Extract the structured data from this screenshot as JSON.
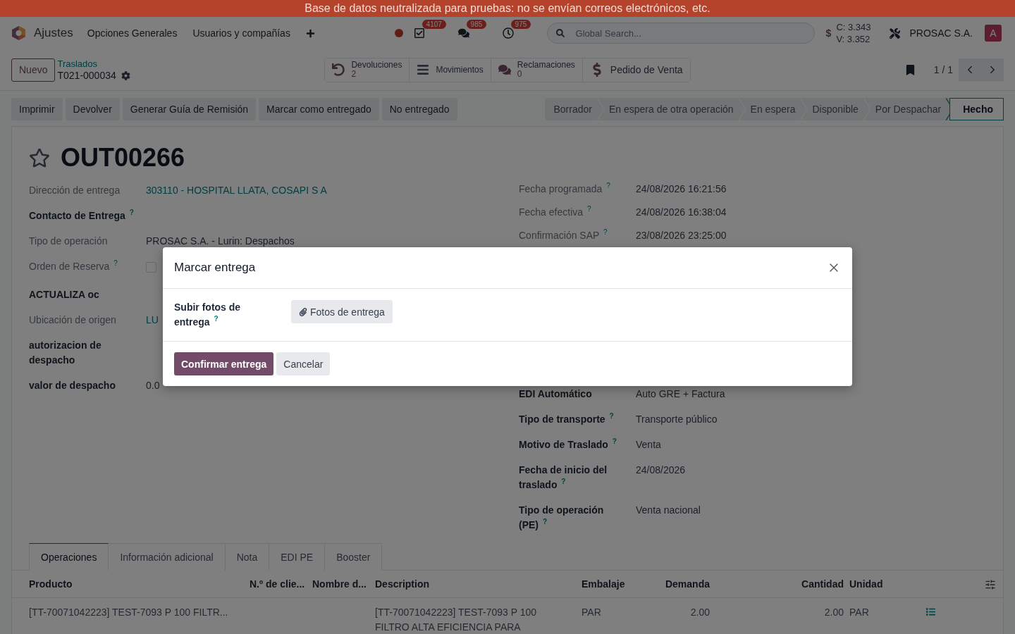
{
  "banner": "Base de datos neutralizada para pruebas: no se envían correos electrónicos, etc.",
  "navbar": {
    "app": "Ajustes",
    "menus": [
      "Opciones Generales",
      "Usuarios y compañías"
    ],
    "notifications": [
      {
        "kind": "activities",
        "count": "4107"
      },
      {
        "kind": "messages",
        "count": "985"
      },
      {
        "kind": "clock",
        "count": "975"
      }
    ],
    "search": {
      "placeholder": "Global Search..."
    },
    "currency": {
      "symbol": "$",
      "lines": [
        "C: 3.343",
        "V: 3.352"
      ]
    },
    "company": "PROSAC S.A.",
    "avatar": "A"
  },
  "control_panel": {
    "new_button": "Nuevo",
    "breadcrumb": {
      "parent": "Traslados",
      "current": "T021-000034"
    },
    "smart_buttons": [
      {
        "kind": "returns",
        "label": "Devoluciones",
        "value": "2"
      },
      {
        "kind": "moves",
        "label": "Movimientos"
      },
      {
        "kind": "claims",
        "label": "Reclamaciones",
        "value": "0"
      },
      {
        "kind": "sale",
        "label": "Pedido de Venta"
      }
    ],
    "pager": "1 / 1"
  },
  "actions": [
    "Imprimir",
    "Devolver",
    "Generar Guía de Remisión",
    "Marcar como entregado",
    "No entregado"
  ],
  "statusbar": [
    {
      "label": "Borrador",
      "selected": false
    },
    {
      "label": "En espera de otra operación",
      "selected": false
    },
    {
      "label": "En espera",
      "selected": false
    },
    {
      "label": "Disponible",
      "selected": false
    },
    {
      "label": "Por Despachar",
      "selected": false
    },
    {
      "label": "Hecho",
      "selected": true
    }
  ],
  "form": {
    "starred": false,
    "title": "OUT00266",
    "left": [
      {
        "label": "Dirección de entrega",
        "readonly": true,
        "kind": "link",
        "value": "303110 - HOSPITAL LLATA, COSAPI S A"
      },
      {
        "label": "Contacto de Entrega $^{?}$",
        "readonly": false,
        "kind": "text"
      },
      {
        "label": "Tipo de operación",
        "readonly": true,
        "kind": "text",
        "value": "PROSAC S.A. - Lurin: Despachos"
      },
      {
        "label": "Orden de Reserva $^{?}$",
        "readonly": true,
        "kind": "checkbox",
        "checked": false
      },
      {
        "label": "ACTUALIZA oc",
        "readonly": false,
        "kind": "text"
      },
      {
        "label": "Ubicación de origen",
        "readonly": true,
        "kind": "link",
        "value": "LU"
      },
      {
        "label": "autorizacion de despacho",
        "readonly": false,
        "kind": "text"
      },
      {
        "label": "valor de despacho",
        "readonly": false,
        "kind": "text",
        "value": "0.0"
      }
    ],
    "right_upper": [
      {
        "label": "Fecha programada $^{?}$",
        "readonly": true,
        "kind": "text",
        "value": "24/08/2026 16:21:56"
      },
      {
        "label": "Fecha efectiva $^{?}$",
        "readonly": true,
        "kind": "text",
        "value": "24/08/2026 16:38:04"
      },
      {
        "label": "Confirmación SAP $^{?}$",
        "readonly": true,
        "kind": "text",
        "value": "23/08/2026 23:25:00"
      }
    ],
    "right_lower": [
      {
        "label": "EDI Automático",
        "readonly": false,
        "kind": "text",
        "value": "Auto GRE + Factura"
      },
      {
        "label": "Tipo de transporte $^{?}$",
        "readonly": false,
        "kind": "text",
        "value": "Transporte público"
      },
      {
        "label": "Motivo de Traslado $^{?}$",
        "readonly": false,
        "kind": "text",
        "value": "Venta"
      },
      {
        "label": "Fecha de inicio del traslado $^{?}$",
        "readonly": false,
        "kind": "text",
        "value": "24/08/2026"
      },
      {
        "label": "Tipo de operación (PE) $^{?}$",
        "readonly": false,
        "kind": "text",
        "value": "Venta nacional"
      }
    ]
  },
  "tabs": [
    {
      "label": "Operaciones",
      "selected": true
    },
    {
      "label": "Información adicional",
      "selected": false
    },
    {
      "label": "Nota",
      "selected": false
    },
    {
      "label": "EDI PE",
      "selected": false
    },
    {
      "label": "Booster",
      "selected": false
    }
  ],
  "table": {
    "columns": [
      {
        "label": "Producto",
        "kind": "text"
      },
      {
        "label": "N.º de clie...",
        "kind": "text"
      },
      {
        "label": "Nombre d...",
        "kind": "text"
      },
      {
        "label": "Description",
        "kind": "text"
      },
      {
        "label": "Embalaje",
        "kind": "text"
      },
      {
        "label": "Demanda",
        "kind": "number"
      },
      {
        "label": "Cantidad",
        "kind": "number"
      },
      {
        "label": "Unidad",
        "kind": "text"
      }
    ],
    "rows": [
      {
        "product": "[TT-70071042223] TEST-7093 P 100 FILTR...",
        "description": "[TT-70071042223] TEST-7093 P 100 FILTRO ALTA EFICIENCIA PARA",
        "packaging": "PAR",
        "demand": "2.00",
        "quantity": "2.00",
        "unit": "PAR"
      }
    ]
  },
  "modal": {
    "title": "Marcar entrega",
    "fields": [
      {
        "label": "Subir fotos de entrega $^{?}$",
        "button": "Fotos de entrega"
      }
    ],
    "buttons": [
      {
        "label": "Confirmar entrega",
        "kind": "primary"
      },
      {
        "label": "Cancelar",
        "kind": "secondary"
      }
    ]
  }
}
